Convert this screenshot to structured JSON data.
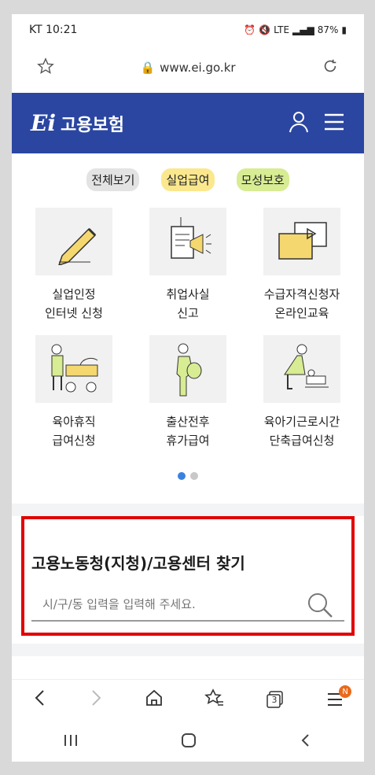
{
  "status": {
    "carrier_time": "KT 10:21",
    "lte": "LTE",
    "battery": "87%"
  },
  "browser": {
    "url": "www.ei.go.kr"
  },
  "header": {
    "logo_mark": "Ei",
    "logo_text": "고용보험"
  },
  "tabs": [
    {
      "label": "전체보기"
    },
    {
      "label": "실업급여"
    },
    {
      "label": "모성보호"
    }
  ],
  "services": [
    {
      "label": "실업인정\n인터넷 신청",
      "icon": "pencil-icon"
    },
    {
      "label": "취업사실\n신고",
      "icon": "document-megaphone-icon"
    },
    {
      "label": "수급자격신청자\n온라인교육",
      "icon": "video-play-icon"
    },
    {
      "label": "육아휴직\n급여신청",
      "icon": "stroller-icon"
    },
    {
      "label": "출산전후\n휴가급여",
      "icon": "pregnant-woman-icon"
    },
    {
      "label": "육아기근로시간\n단축급여신청",
      "icon": "parent-baby-icon"
    }
  ],
  "finder": {
    "title": "고용노동청(지청)/고용센터 찾기",
    "placeholder": "시/구/동 입력을 입력해 주세요."
  },
  "browser_nav": {
    "tabs_count": "3",
    "menu_badge": "N"
  },
  "colors": {
    "header": "#2b46a1",
    "highlight": "#e10000",
    "dot_active": "#3a82e0"
  }
}
